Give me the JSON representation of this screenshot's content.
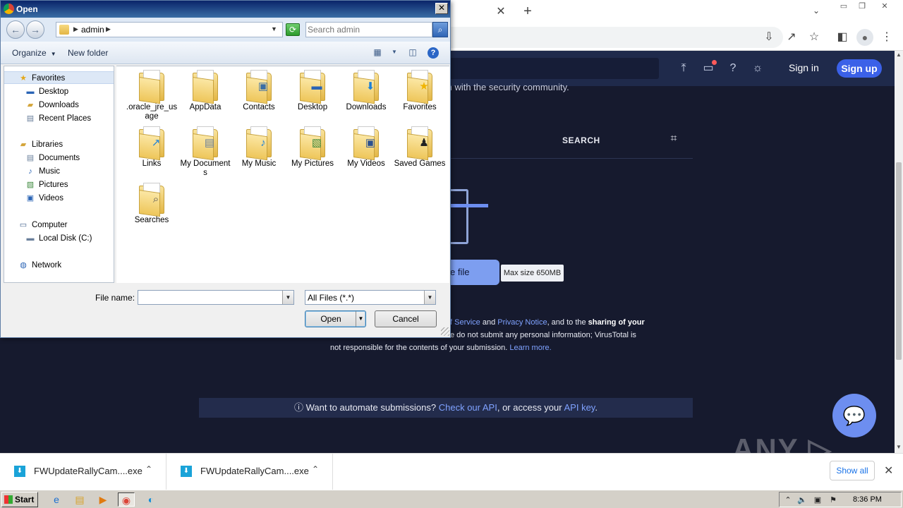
{
  "browser": {
    "tab_close_glyph": "✕",
    "new_tab_glyph": "+",
    "tab_dropdown_glyph": "⌄",
    "icons": [
      "download-icon",
      "share-icon",
      "star-icon",
      "sidebar-icon",
      "profile-icon",
      "menu-icon"
    ]
  },
  "virustotal": {
    "tagline": "m with the security community.",
    "sign_in": "Sign in",
    "sign_up": "Sign up",
    "tab_search": "SEARCH",
    "choose_file": "e file",
    "max_size": "Max size 650MB",
    "terms": {
      "frag1": "f Service",
      "and1": " and ",
      "privacy": "Privacy Notice",
      "frag2": ", and to the ",
      "sharing": "sharing of your",
      "line2": "e do not submit any personal information; VirusTotal is",
      "line3": "not responsible for the contents of your submission. ",
      "learn_more": "Learn more."
    },
    "api_banner": {
      "prefix": "ⓘ Want to automate submissions? ",
      "check_api": "Check our API",
      "middle": ", or access your ",
      "api_key": "API key",
      "suffix": "."
    },
    "watermark": "ANY ▷ RUN"
  },
  "downloads": {
    "items": [
      {
        "name": "FWUpdateRallyCam....exe"
      },
      {
        "name": "FWUpdateRallyCam....exe"
      }
    ],
    "show_all": "Show all",
    "close_glyph": "✕"
  },
  "taskbar": {
    "start": "Start",
    "clock": "8:36 PM"
  },
  "dialog": {
    "title": "Open",
    "close_glyph": "✕",
    "address": "admin",
    "search_placeholder": "Search admin",
    "organize": "Organize",
    "new_folder": "New folder",
    "nav": {
      "favorites": "Favorites",
      "desktop": "Desktop",
      "downloads": "Downloads",
      "recent_places": "Recent Places",
      "libraries": "Libraries",
      "documents": "Documents",
      "music": "Music",
      "pictures": "Pictures",
      "videos": "Videos",
      "computer": "Computer",
      "local_disk": "Local Disk (C:)",
      "network": "Network"
    },
    "files": [
      {
        "label": ".oracle_jre_usage",
        "icon": "folder-icon"
      },
      {
        "label": "AppData",
        "icon": "folder-icon"
      },
      {
        "label": "Contacts",
        "icon": "contacts-folder-icon"
      },
      {
        "label": "Desktop",
        "icon": "desktop-folder-icon"
      },
      {
        "label": "Downloads",
        "icon": "downloads-folder-icon"
      },
      {
        "label": "Favorites",
        "icon": "favorites-folder-icon"
      },
      {
        "label": "Links",
        "icon": "links-folder-icon"
      },
      {
        "label": "My Documents",
        "icon": "documents-folder-icon"
      },
      {
        "label": "My Music",
        "icon": "music-folder-icon"
      },
      {
        "label": "My Pictures",
        "icon": "pictures-folder-icon"
      },
      {
        "label": "My Videos",
        "icon": "videos-folder-icon"
      },
      {
        "label": "Saved Games",
        "icon": "saved-games-folder-icon"
      },
      {
        "label": "Searches",
        "icon": "searches-folder-icon"
      }
    ],
    "file_name_label": "File name:",
    "file_name_value": "",
    "file_type": "All Files (*.*)",
    "open_button": "Open",
    "cancel_button": "Cancel"
  }
}
